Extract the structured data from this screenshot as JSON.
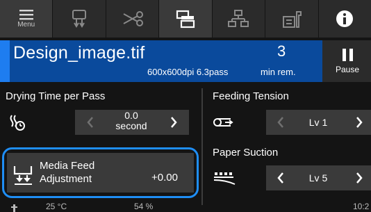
{
  "toolbar": {
    "menu_label": "Menu"
  },
  "job": {
    "file_name": "Design_image.tif",
    "print_settings": "600x600dpi 6.3pass",
    "remaining_value": "3",
    "remaining_unit": "min rem.",
    "progress_percent": 3,
    "pause_label": "Pause"
  },
  "drying": {
    "title": "Drying Time per Pass",
    "value": "0.0",
    "unit": "second"
  },
  "feeding_tension": {
    "title": "Feeding Tension",
    "value": "Lv 1"
  },
  "paper_suction": {
    "title": "Paper Suction",
    "value": "Lv 5"
  },
  "media_feed": {
    "label_line1": "Media Feed",
    "label_line2": "Adjustment",
    "value": "+0.00"
  },
  "status": {
    "temperature": "25 °C",
    "humidity": "54 %",
    "time": "10:2"
  },
  "colors": {
    "accent_blue": "#1f8ef5",
    "job_bar_blue": "#0a4a9c",
    "toolbar_bg": "#2b2b2b",
    "button_bg": "#3a3a3a"
  }
}
